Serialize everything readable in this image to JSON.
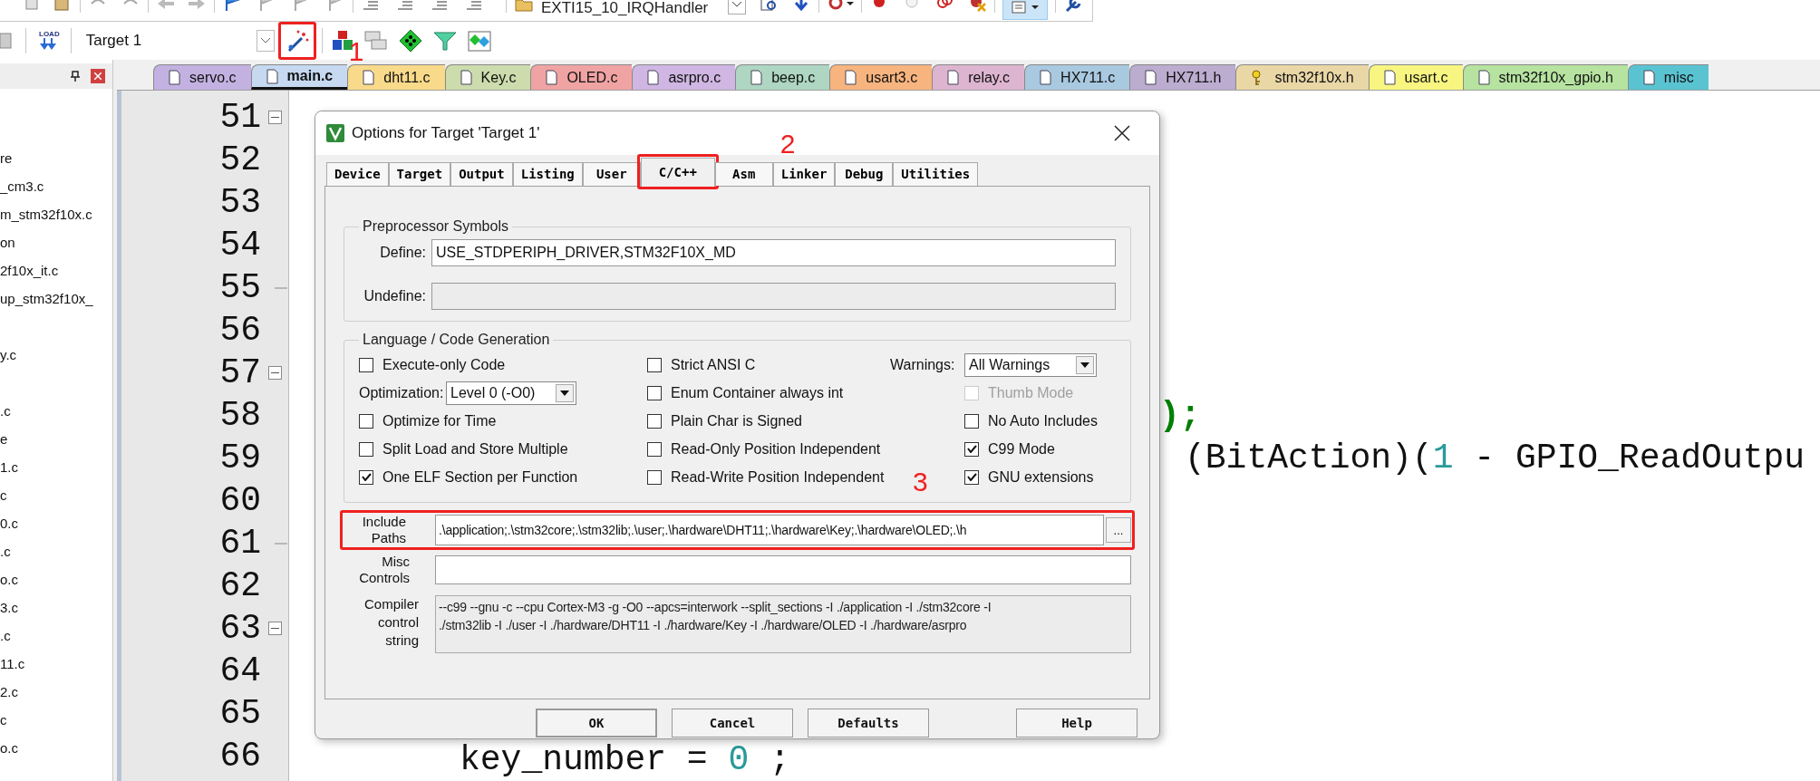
{
  "toolbar_top": {
    "function_select": {
      "value": "EXTI15_10_IRQHandler"
    }
  },
  "toolbar_build": {
    "load_label": "LOAD",
    "target_select": {
      "value": "Target 1"
    },
    "options_tool": {
      "highlighted": true,
      "callout": "1"
    }
  },
  "sidebar": {
    "groups": [
      {
        "items": [
          "re",
          "_cm3.c",
          "m_stm32f10x.c",
          "on",
          "2f10x_it.c",
          "up_stm32f10x_"
        ]
      },
      {
        "items": [
          "y.c"
        ]
      },
      {
        "items": [
          ".c",
          "e",
          "1.c",
          "c",
          "0.c",
          ".c",
          "o.c",
          "3.c",
          ".c",
          "11.c",
          "2.c",
          "c",
          "o.c"
        ]
      }
    ]
  },
  "tabs": [
    {
      "label": "servo.c",
      "selected": false,
      "color": "#c3b1e1",
      "kind": "file"
    },
    {
      "label": "main.c",
      "selected": true,
      "color": "#c6d9f1",
      "kind": "file"
    },
    {
      "label": "dht11.c",
      "selected": false,
      "color": "#f9da8b",
      "kind": "file"
    },
    {
      "label": "Key.c",
      "selected": false,
      "color": "#cddcad",
      "kind": "file"
    },
    {
      "label": "OLED.c",
      "selected": false,
      "color": "#f0a3a3",
      "kind": "file"
    },
    {
      "label": "asrpro.c",
      "selected": false,
      "color": "#cfb6e3",
      "kind": "file"
    },
    {
      "label": "beep.c",
      "selected": false,
      "color": "#aed6c2",
      "kind": "file"
    },
    {
      "label": "usart3.c",
      "selected": false,
      "color": "#f7b47f",
      "kind": "file"
    },
    {
      "label": "relay.c",
      "selected": false,
      "color": "#ddb5d0",
      "kind": "file"
    },
    {
      "label": "HX711.c",
      "selected": false,
      "color": "#a9c9e0",
      "kind": "file"
    },
    {
      "label": "HX711.h",
      "selected": false,
      "color": "#bcaccf",
      "kind": "file"
    },
    {
      "label": "stm32f10x.h",
      "selected": false,
      "color": "#ead7a6",
      "kind": "readonly"
    },
    {
      "label": "usart.c",
      "selected": false,
      "color": "#f8f681",
      "kind": "file"
    },
    {
      "label": "stm32f10x_gpio.h",
      "selected": false,
      "color": "#b6e3a0",
      "kind": "file"
    },
    {
      "label": "misc",
      "selected": false,
      "color": "#5ac3d2",
      "kind": "file"
    }
  ],
  "editor": {
    "lines": [
      {
        "number": "51",
        "fold_start": true
      },
      {
        "number": "52"
      },
      {
        "number": "53"
      },
      {
        "number": "54"
      },
      {
        "number": "55",
        "fold_end": true
      },
      {
        "number": "56"
      },
      {
        "number": "57",
        "fold_start": true
      },
      {
        "number": "58",
        "code": [
          {
            "kind": "punct",
            "text": ");"
          }
        ]
      },
      {
        "number": "59",
        "code": [
          {
            "kind": "plain",
            "text": "(BitAction)("
          },
          {
            "kind": "number",
            "text": "1"
          },
          {
            "kind": "plain",
            "text": " - GPIO_ReadOutpu"
          }
        ]
      },
      {
        "number": "60"
      },
      {
        "number": "61",
        "fold_end": true
      },
      {
        "number": "62"
      },
      {
        "number": "63",
        "fold_start": true
      },
      {
        "number": "64"
      },
      {
        "number": "65"
      },
      {
        "number": "66",
        "code": [
          {
            "kind": "plain",
            "text": "key_number = "
          },
          {
            "kind": "number",
            "text": "0"
          },
          {
            "kind": "plain",
            "text": " ;"
          }
        ]
      }
    ]
  },
  "dialog": {
    "title": "Options for Target 'Target 1'",
    "tabs": [
      {
        "label": "Device",
        "selected": false
      },
      {
        "label": "Target",
        "selected": false
      },
      {
        "label": "Output",
        "selected": false
      },
      {
        "label": "Listing",
        "selected": false
      },
      {
        "label": "User",
        "selected": false
      },
      {
        "label": "C/C++",
        "selected": true,
        "highlighted": true,
        "callout": "2"
      },
      {
        "label": "Asm",
        "selected": false
      },
      {
        "label": "Linker",
        "selected": false
      },
      {
        "label": "Debug",
        "selected": false
      },
      {
        "label": "Utilities",
        "selected": false
      }
    ],
    "preprocessor": {
      "title": "Preprocessor Symbols",
      "define": {
        "label": "Define:",
        "value": "USE_STDPERIPH_DRIVER,STM32F10X_MD",
        "disabled": false
      },
      "undefine": {
        "label": "Undefine:",
        "disabled": true
      }
    },
    "language": {
      "title": "Language / Code Generation",
      "rows": [
        [
          {
            "kind": "checkbox",
            "label": "Execute-only Code",
            "checked": false,
            "disabled": false
          },
          {
            "kind": "checkbox",
            "label": "Strict ANSI C",
            "checked": false,
            "disabled": false
          },
          {
            "kind": "select",
            "label": "Warnings:",
            "value": "All Warnings"
          }
        ],
        [
          {
            "kind": "select",
            "label": "Optimization:",
            "value": "Level 0 (-O0)"
          },
          {
            "kind": "checkbox",
            "label": "Enum Container always int",
            "checked": false,
            "disabled": false
          },
          {
            "kind": "checkbox",
            "label": "Thumb Mode",
            "checked": false,
            "disabled": true
          }
        ],
        [
          {
            "kind": "checkbox",
            "label": "Optimize for Time",
            "checked": false,
            "disabled": false
          },
          {
            "kind": "checkbox",
            "label": "Plain Char is Signed",
            "checked": false,
            "disabled": false
          },
          {
            "kind": "checkbox",
            "label": "No Auto Includes",
            "checked": false,
            "disabled": false
          }
        ],
        [
          {
            "kind": "checkbox",
            "label": "Split Load and Store Multiple",
            "checked": false,
            "disabled": false
          },
          {
            "kind": "checkbox",
            "label": "Read-Only Position Independent",
            "checked": false,
            "disabled": false
          },
          {
            "kind": "checkbox",
            "label": "C99 Mode",
            "checked": true,
            "disabled": false
          }
        ],
        [
          {
            "kind": "checkbox",
            "label": "One ELF Section per Function",
            "checked": true,
            "disabled": false
          },
          {
            "kind": "checkbox",
            "label": "Read-Write Position Independent",
            "checked": false,
            "disabled": false
          },
          {
            "kind": "checkbox",
            "label": "GNU extensions",
            "checked": true,
            "disabled": false
          }
        ]
      ]
    },
    "include_paths": {
      "label": "Include Paths",
      "value": ".\\application;.\\stm32core;.\\stm32lib;.\\user;.\\hardware\\DHT11;.\\hardware\\Key;.\\hardware\\OLED;.\\h",
      "browse": "...",
      "highlighted": true,
      "callout": "3"
    },
    "misc_controls": {
      "label": "Misc Controls"
    },
    "compiler_string": {
      "label": "Compiler control string",
      "lines": [
        "--c99 --gnu -c --cpu Cortex-M3 -g -O0 --apcs=interwork --split_sections -I ./application -I ./stm32core -I",
        "./stm32lib -I ./user -I ./hardware/DHT11 -I ./hardware/Key -I ./hardware/OLED -I ./hardware/asrpro"
      ]
    },
    "buttons": [
      "OK",
      "Cancel",
      "Defaults",
      "Help"
    ]
  }
}
